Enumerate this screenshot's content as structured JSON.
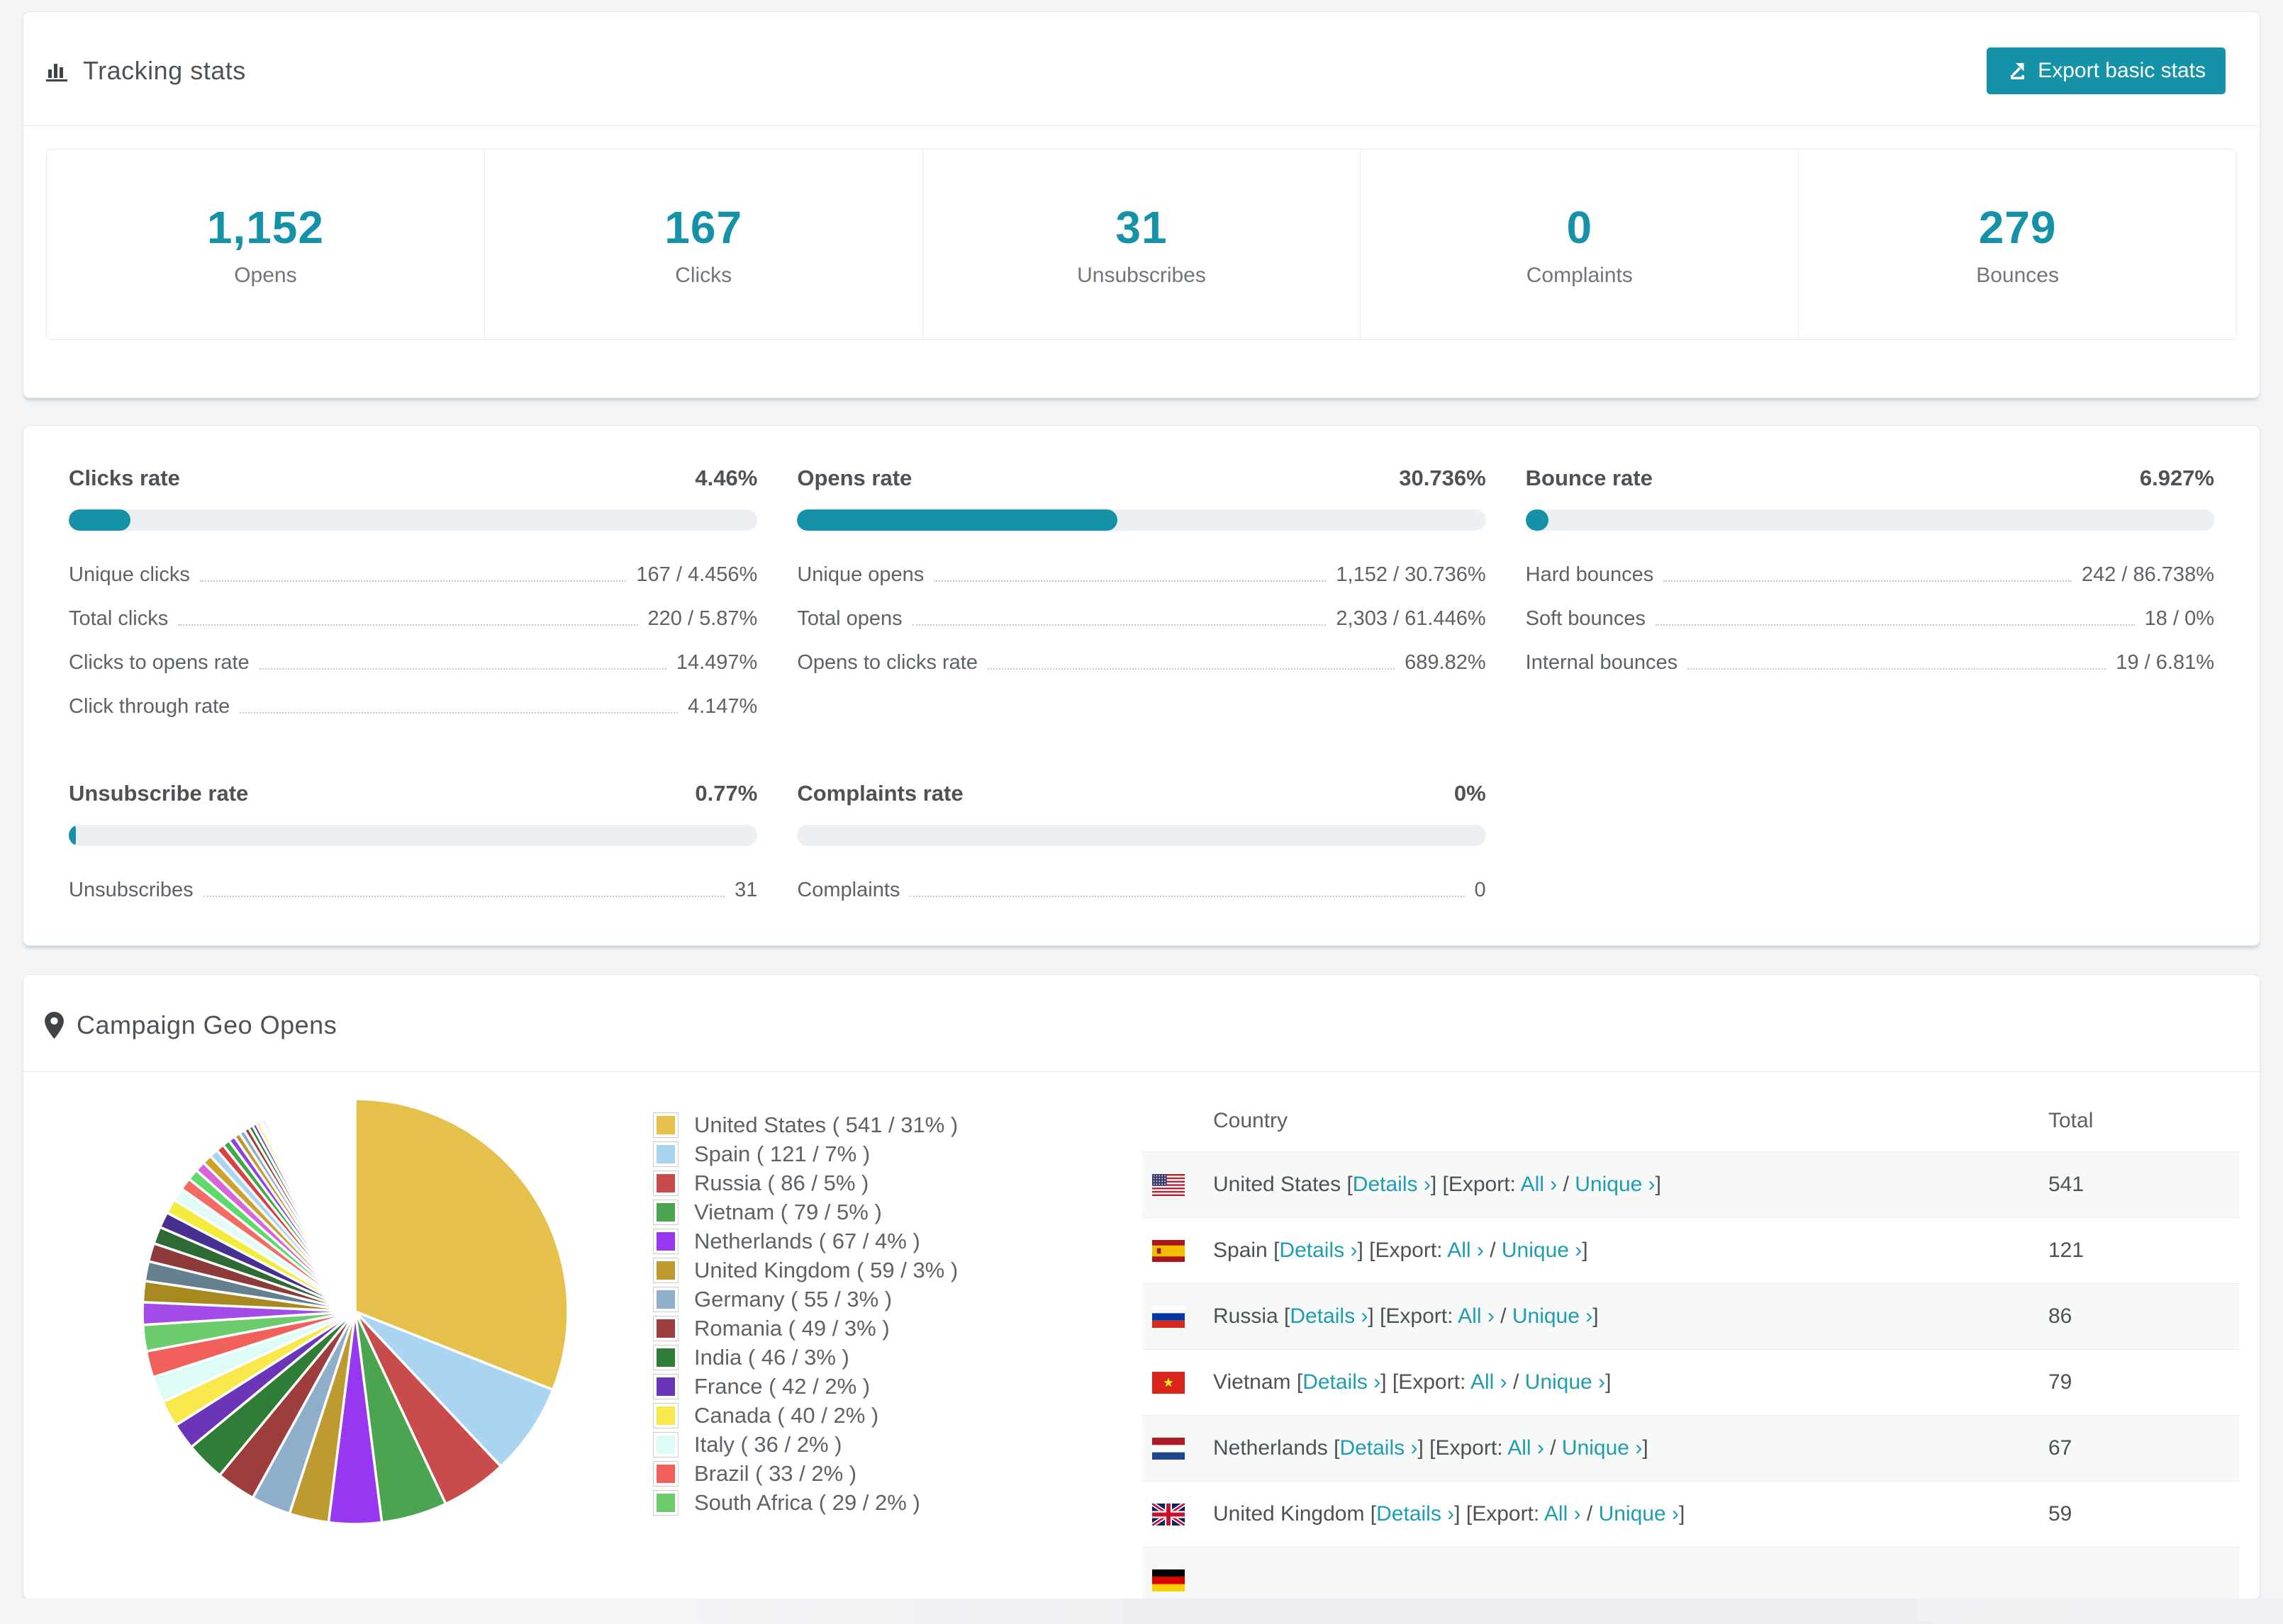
{
  "theme": {
    "accent": "#1592A7",
    "link": "#1E9CB2",
    "bar_track": "#edf0f2",
    "stripe": "#f7f8f8"
  },
  "tracking": {
    "title": "Tracking stats",
    "export_button": "Export basic stats",
    "stats": [
      {
        "value": "1,152",
        "label": "Opens"
      },
      {
        "value": "167",
        "label": "Clicks"
      },
      {
        "value": "31",
        "label": "Unsubscribes"
      },
      {
        "value": "0",
        "label": "Complaints"
      },
      {
        "value": "279",
        "label": "Bounces"
      }
    ]
  },
  "rates": [
    {
      "title": "Clicks rate",
      "value": "4.46%",
      "bar_pct": 9,
      "rows": [
        {
          "label": "Unique clicks",
          "value": "167 / 4.456%"
        },
        {
          "label": "Total clicks",
          "value": "220 / 5.87%"
        },
        {
          "label": "Clicks to opens rate",
          "value": "14.497%"
        },
        {
          "label": "Click through rate",
          "value": "4.147%"
        }
      ]
    },
    {
      "title": "Opens rate",
      "value": "30.736%",
      "bar_pct": 46.5,
      "rows": [
        {
          "label": "Unique opens",
          "value": "1,152 / 30.736%"
        },
        {
          "label": "Total opens",
          "value": "2,303 / 61.446%"
        },
        {
          "label": "Opens to clicks rate",
          "value": "689.82%"
        }
      ]
    },
    {
      "title": "Bounce rate",
      "value": "6.927%",
      "bar_pct": 3.3,
      "rows": [
        {
          "label": "Hard bounces",
          "value": "242 / 86.738%"
        },
        {
          "label": "Soft bounces",
          "value": "18 / 0%"
        },
        {
          "label": "Internal bounces",
          "value": "19 / 6.81%"
        }
      ]
    },
    {
      "title": "Unsubscribe rate",
      "value": "0.77%",
      "bar_pct": 1,
      "rows": [
        {
          "label": "Unsubscribes",
          "value": "31"
        }
      ]
    },
    {
      "title": "Complaints rate",
      "value": "0%",
      "bar_pct": 0,
      "rows": [
        {
          "label": "Complaints",
          "value": "0"
        }
      ]
    }
  ],
  "geo": {
    "title": "Campaign Geo Opens",
    "table": {
      "country_header": "Country",
      "total_header": "Total",
      "details_label": "Details ›",
      "export_label": "Export:",
      "all_label": "All ›",
      "unique_label": "Unique ›",
      "rows": [
        {
          "country": "United States",
          "flag": "us",
          "total": "541",
          "partial": false
        },
        {
          "country": "Spain",
          "flag": "es",
          "total": "121",
          "partial": false
        },
        {
          "country": "Russia",
          "flag": "ru",
          "total": "86",
          "partial": false
        },
        {
          "country": "Vietnam",
          "flag": "vn",
          "total": "79",
          "partial": false
        },
        {
          "country": "Netherlands",
          "flag": "nl",
          "total": "67",
          "partial": false
        },
        {
          "country": "United Kingdom",
          "flag": "gb",
          "total": "59",
          "partial": false
        },
        {
          "country": "",
          "flag": "de",
          "total": "",
          "partial": true
        }
      ]
    }
  },
  "chart_data": {
    "type": "pie",
    "title": "Campaign Geo Opens",
    "legend_position": "right",
    "start_angle": "top",
    "direction": "clockwise",
    "slices": [
      {
        "label": "United States",
        "total": 541,
        "pct": 31,
        "color": "#E5C14B"
      },
      {
        "label": "Spain",
        "total": 121,
        "pct": 7,
        "color": "#ABD4F0"
      },
      {
        "label": "Russia",
        "total": 86,
        "pct": 5,
        "color": "#C94C4C"
      },
      {
        "label": "Vietnam",
        "total": 79,
        "pct": 5,
        "color": "#4BA44F"
      },
      {
        "label": "Netherlands",
        "total": 67,
        "pct": 4,
        "color": "#9737F2"
      },
      {
        "label": "United Kingdom",
        "total": 59,
        "pct": 3,
        "color": "#BE9B31"
      },
      {
        "label": "Germany",
        "total": 55,
        "pct": 3,
        "color": "#8FAEC9"
      },
      {
        "label": "Romania",
        "total": 49,
        "pct": 3,
        "color": "#9E3D3D"
      },
      {
        "label": "India",
        "total": 46,
        "pct": 3,
        "color": "#2F7D36"
      },
      {
        "label": "France",
        "total": 42,
        "pct": 2,
        "color": "#6B35B8"
      },
      {
        "label": "Canada",
        "total": 40,
        "pct": 2,
        "color": "#F8E84B"
      },
      {
        "label": "Italy",
        "total": 36,
        "pct": 2,
        "color": "#DDFCF8"
      },
      {
        "label": "Brazil",
        "total": 33,
        "pct": 2,
        "color": "#F2605C"
      },
      {
        "label": "South Africa",
        "total": 29,
        "pct": 2,
        "color": "#6CCB6C"
      }
    ],
    "other_slices": [
      {
        "c": "#A24BE8",
        "v": 1.7
      },
      {
        "c": "#A8891F",
        "v": 1.6
      },
      {
        "c": "#64808F",
        "v": 1.5
      },
      {
        "c": "#8C3A3A",
        "v": 1.4
      },
      {
        "c": "#2E6B34",
        "v": 1.3
      },
      {
        "c": "#473091",
        "v": 1.2
      },
      {
        "c": "#F2EC3D",
        "v": 1.1
      },
      {
        "c": "#E3FBF7",
        "v": 1.0
      },
      {
        "c": "#F56A62",
        "v": 0.92
      },
      {
        "c": "#5FD969",
        "v": 0.85
      },
      {
        "c": "#D964D9",
        "v": 0.78
      },
      {
        "c": "#CBA32B",
        "v": 0.72
      },
      {
        "c": "#ABD4F0",
        "v": 0.66
      },
      {
        "c": "#D94040",
        "v": 0.6
      },
      {
        "c": "#43A847",
        "v": 0.55
      },
      {
        "c": "#8A43E8",
        "v": 0.5
      },
      {
        "c": "#BE9B31",
        "v": 0.46
      },
      {
        "c": "#8FAEC9",
        "v": 0.42
      },
      {
        "c": "#9E3D3D",
        "v": 0.38
      },
      {
        "c": "#2F7D36",
        "v": 0.34
      },
      {
        "c": "#6B35B8",
        "v": 0.3
      },
      {
        "c": "#F8E84B",
        "v": 0.27
      },
      {
        "c": "#DDFCF8",
        "v": 0.24
      },
      {
        "c": "#F2605C",
        "v": 0.21
      },
      {
        "c": "#6CCB6C",
        "v": 0.19
      },
      {
        "c": "#E06CE0",
        "v": 0.17
      },
      {
        "c": "#E5C14B",
        "v": 0.15
      },
      {
        "c": "#ABD4F0",
        "v": 0.13
      },
      {
        "c": "#C94C4C",
        "v": 0.11
      },
      {
        "c": "#4BA44F",
        "v": 0.1
      },
      {
        "c": "#9737F2",
        "v": 0.09
      },
      {
        "c": "#BE9B31",
        "v": 0.08
      },
      {
        "c": "#8FAEC9",
        "v": 0.07
      },
      {
        "c": "#9E3D3D",
        "v": 0.06
      },
      {
        "c": "#2F7D36",
        "v": 0.05
      },
      {
        "c": "#6B35B8",
        "v": 0.045
      },
      {
        "c": "#F8E84B",
        "v": 0.04
      },
      {
        "c": "#F2605C",
        "v": 0.035
      },
      {
        "c": "#A24BE8",
        "v": 0.03
      },
      {
        "c": "#43A847",
        "v": 0.025
      }
    ]
  }
}
